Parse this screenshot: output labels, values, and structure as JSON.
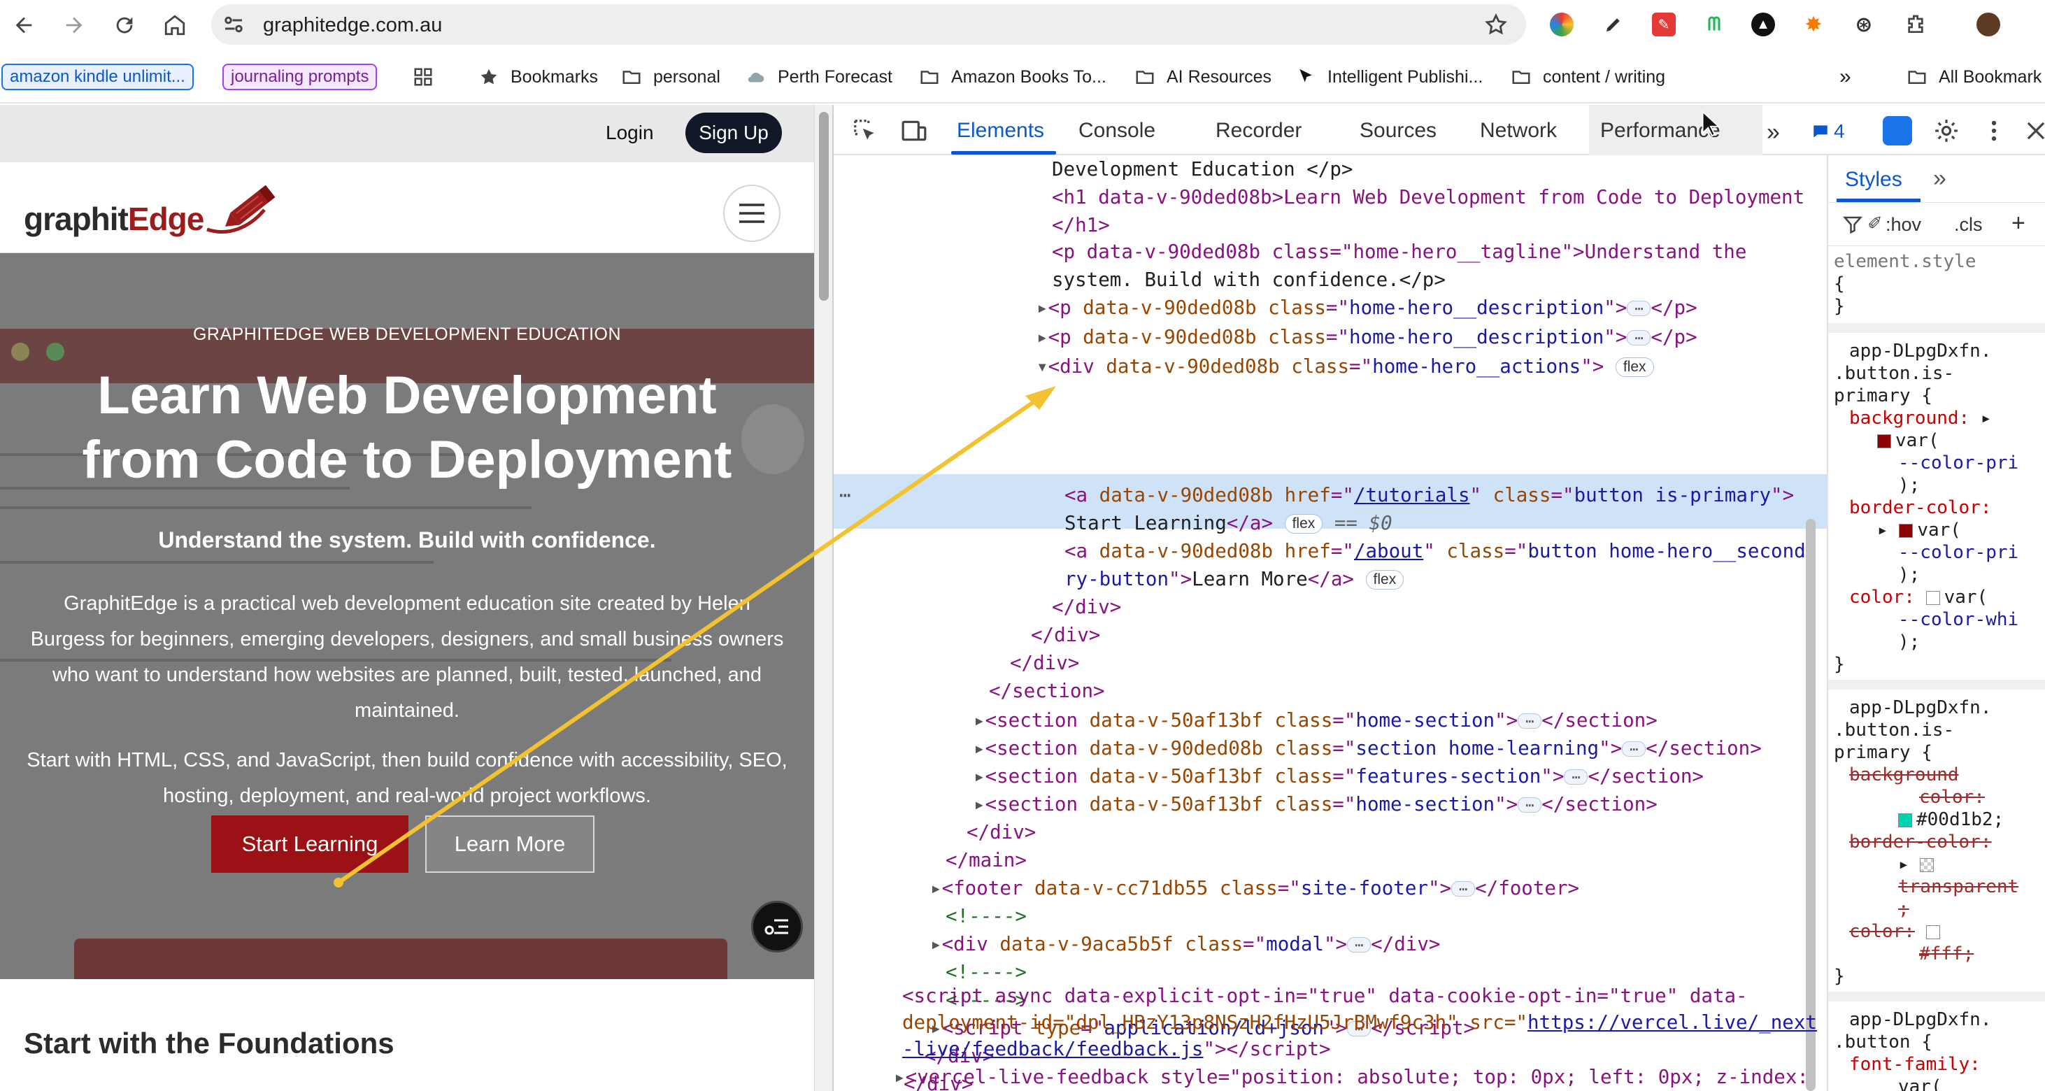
{
  "browser": {
    "url": "graphitedge.com.au",
    "extensions": [
      "colorful-ext-icon",
      "pen-ext-icon",
      "red-ext-icon",
      "green-ext-icon",
      "black-circle-ext-icon",
      "sun-ext-icon",
      "openai-ext-icon",
      "puzzle-icon",
      "avatar"
    ]
  },
  "bookmarks": {
    "chip1": "amazon kindle unlimit...",
    "chip2": "journaling prompts",
    "items": [
      "Bookmarks",
      "personal",
      "Perth Forecast",
      "Amazon Books To...",
      "AI Resources",
      "Intelligent Publishi...",
      "content / writing"
    ],
    "all": "All Bookmark"
  },
  "site": {
    "login": "Login",
    "signup": "Sign Up",
    "logo_part1": "graphit",
    "logo_part2": "Edge",
    "eyebrow": "GRAPHITEDGE WEB DEVELOPMENT EDUCATION",
    "h1_line1": "Learn Web Development",
    "h1_line2": "from Code to Deployment",
    "tagline": "Understand the system. Build with confidence.",
    "desc1": "GraphitEdge is a practical web development education site created by Helen Burgess for beginners, emerging developers, designers, and small business owners who want to understand how websites are planned, built, tested, launched, and maintained.",
    "desc2": "Start with HTML, CSS, and JavaScript, then build confidence with accessibility, SEO, hosting, deployment, and real-world project workflows.",
    "primary_button": "Start Learning",
    "secondary_button": "Learn More",
    "section_title": "Start with the Foundations"
  },
  "devtools": {
    "tabs": [
      "Elements",
      "Console",
      "Recorder",
      "Sources",
      "Network",
      "Performance"
    ],
    "active_tab": "Elements",
    "issues_count": "4",
    "styles_tab": "Styles",
    "filter_hov": ":hov",
    "filter_cls": ".cls"
  },
  "dom": {
    "l1_text": "Development Education </p>",
    "l2_h1": "<h1 data-v-90ded08b>Learn Web Development from Code to Deployment",
    "l3": "</h1>",
    "l4a": "<p data-v-90ded08b class=\"home-hero__tagline\">Understand the",
    "l4b": "system. Build with confidence.</p>",
    "desc_class": "home-hero__description",
    "actions_class": "home-hero__actions",
    "a1_href": "/tutorials",
    "a1_class": "button is-primary",
    "a1_text": "Start Learning",
    "selected_marker": "== $0",
    "a2_href": "/about",
    "a2_class_1": "button home-hero__seconda",
    "a2_class_2": "ry-button",
    "a2_text": "Learn More",
    "flex": "flex",
    "section1": "home-section",
    "section2": "section home-learning",
    "section3": "features-section",
    "section4": "home-section",
    "footer_class": "site-footer",
    "modal_class": "modal",
    "comment": "<!---->",
    "script_type": "application/ld+json",
    "vercel_line1": "<script async data-explicit-opt-in=\"true\" data-cookie-opt-in=\"true\" data-",
    "vercel_line2a": "deployment-id=\"dpl_HBzY13p8NSzH2fHzU5JrBMwf9c3h\" src=\"",
    "vercel_link1": "https://vercel.live/_next",
    "vercel_link2": "-live/feedback/feedback.js",
    "vercel_line4": "<vercel-live-feedback style=\"position: absolute; top: 0px; left: 0px; z-index:"
  },
  "styles": {
    "element_style": "element.style",
    "rule1_source": "app-DLpgDxfn.",
    "rule1_selector_a": ".button.is-",
    "rule1_selector_b": "primary {",
    "background": "background:",
    "var_open": "var(",
    "color_pri": "--color-pri",
    "border_color": "border-color:",
    "color": "color:",
    "color_whi": "--color-whi",
    "bg_color_struck": "background",
    "bg_color_struck2": "color:",
    "teal_value": "#00d1b2;",
    "border_color_struck": "border-color:",
    "transparent": "transparent",
    "color_struck": "color:",
    "white_value": "#fff;",
    "rule3_selector": ".button {",
    "font_family": "font-family:",
    "teal": "#00d1b2",
    "maroon": "#8b0000"
  }
}
